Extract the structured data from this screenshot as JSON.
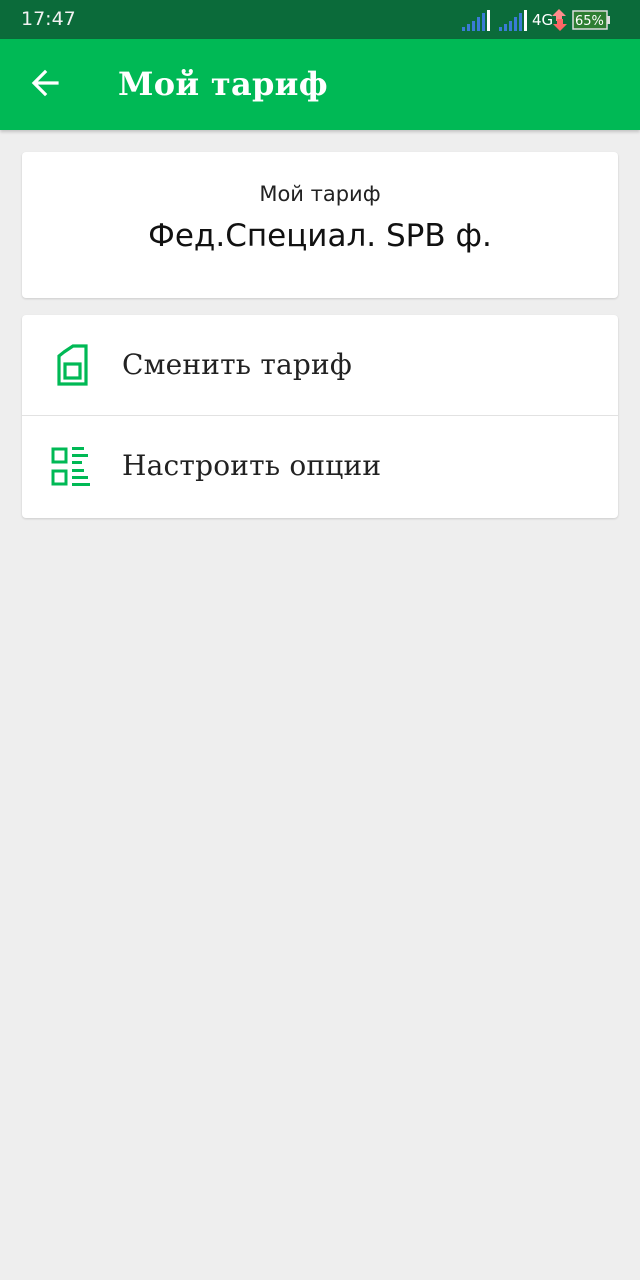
{
  "status_bar": {
    "time": "17:47",
    "network": "4G",
    "battery": "65%",
    "icons": [
      "signal-icon",
      "signal-icon",
      "data-arrows-icon",
      "battery-icon"
    ]
  },
  "app_bar": {
    "title": "Мой тариф",
    "back_icon": "arrow-left-icon"
  },
  "tariff_card": {
    "label": "Мой тариф",
    "name": "Фед.Специал. SPB ф."
  },
  "menu": {
    "items": [
      {
        "label": "Сменить тариф",
        "icon": "sim-card-icon"
      },
      {
        "label": "Настроить опции",
        "icon": "options-list-icon"
      }
    ]
  },
  "colors": {
    "accent": "#00b955",
    "status_bar": "#0b6b3a",
    "background": "#eeeeee"
  }
}
